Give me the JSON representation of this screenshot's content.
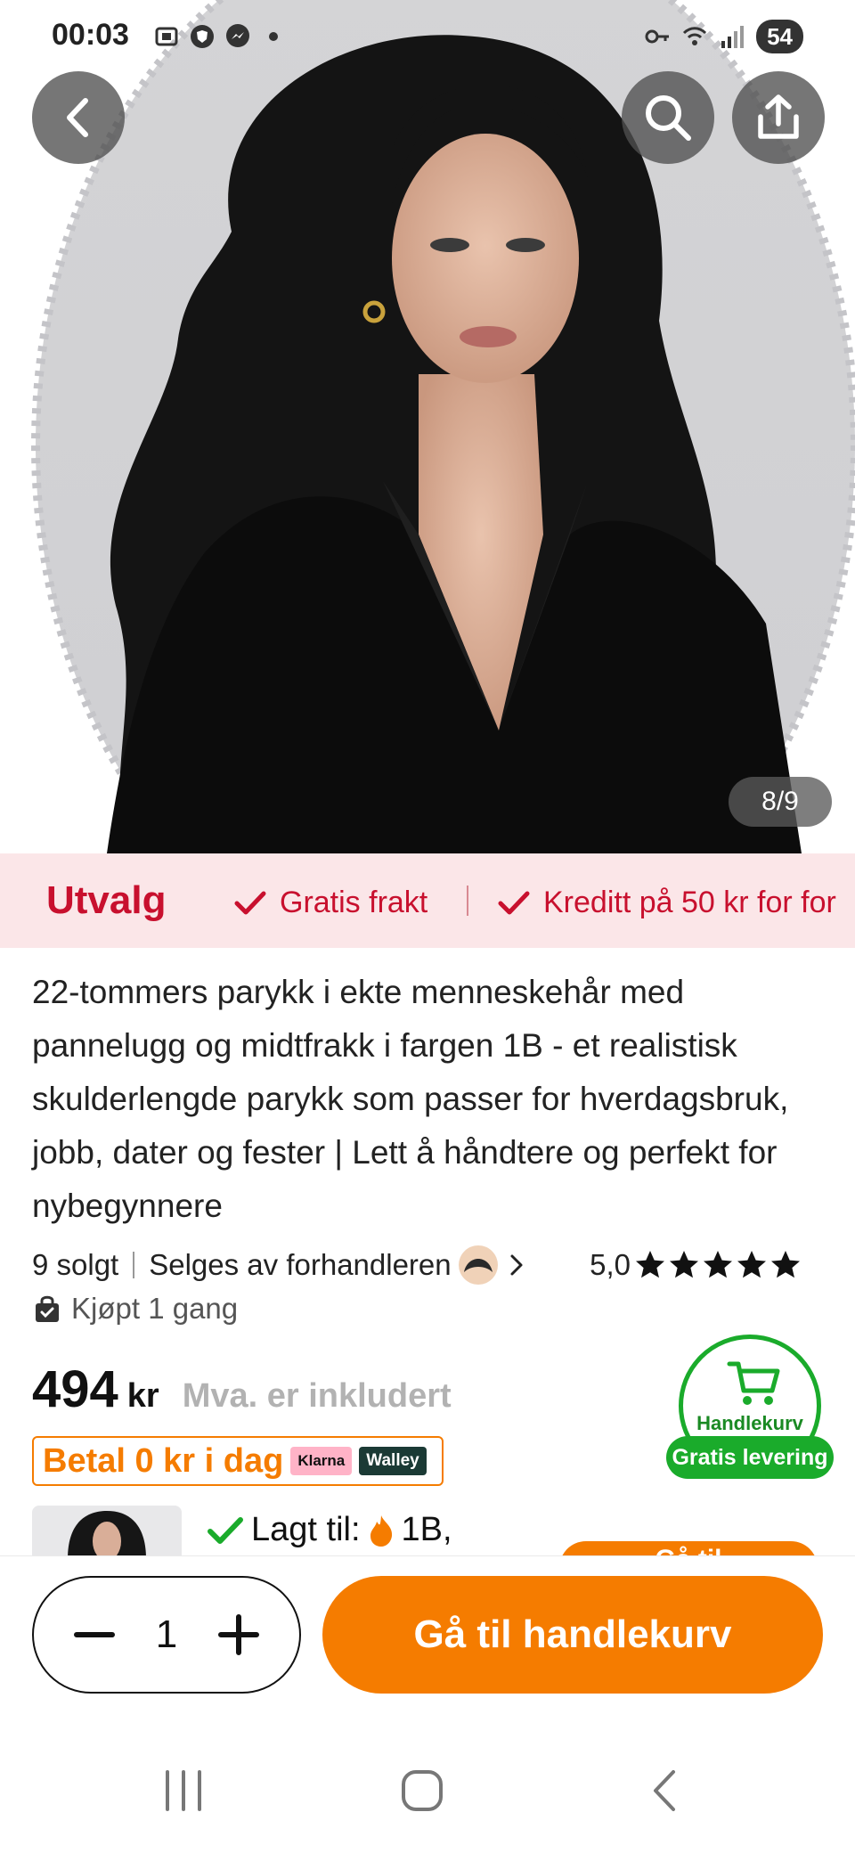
{
  "status_bar": {
    "time": "00:03",
    "left_icons": [
      "screenshot-icon",
      "shield-app-icon",
      "messenger-icon",
      "dot-icon"
    ],
    "right_icons": [
      "key-icon",
      "wifi-icon",
      "signal-icon"
    ],
    "battery": "54"
  },
  "gallery": {
    "counter": "8/9",
    "image": "product-photo-woman-long-black-wavy-hair"
  },
  "banner": {
    "title": "Utvalg",
    "items": [
      "Gratis frakt",
      "Kreditt på 50 kr for for"
    ]
  },
  "product": {
    "title": "22-tommers parykk i ekte menneskehår med pannelugg og midtfrakk i fargen 1B - et realistisk skulderlengde parykk som passer for hverdagsbruk, jobb, dater og fester | Lett å håndtere og perfekt for nybegynnere",
    "sold": "9 solgt",
    "seller": "Selges av forhandleren",
    "rating": "5,0",
    "stars": 5,
    "bought": "Kjøpt 1 gang",
    "price": "494",
    "currency": "kr",
    "vat_note": "Mva. er inkludert",
    "pay_later": "Betal 0 kr i dag",
    "pay_providers": [
      "Klarna",
      "Walley"
    ]
  },
  "cart_badge": {
    "label": "Handlekurv",
    "free_delivery": "Gratis levering"
  },
  "added": {
    "label": "Lagt til:",
    "variant": "1B,",
    "peek_button": "Gå til"
  },
  "bottom": {
    "quantity": "1",
    "checkout": "Gå til handlekurv"
  },
  "colors": {
    "accent_orange": "#f57c00",
    "banner_red": "#c8102e",
    "banner_bg": "#fbe6e8",
    "green": "#1aab2b"
  }
}
